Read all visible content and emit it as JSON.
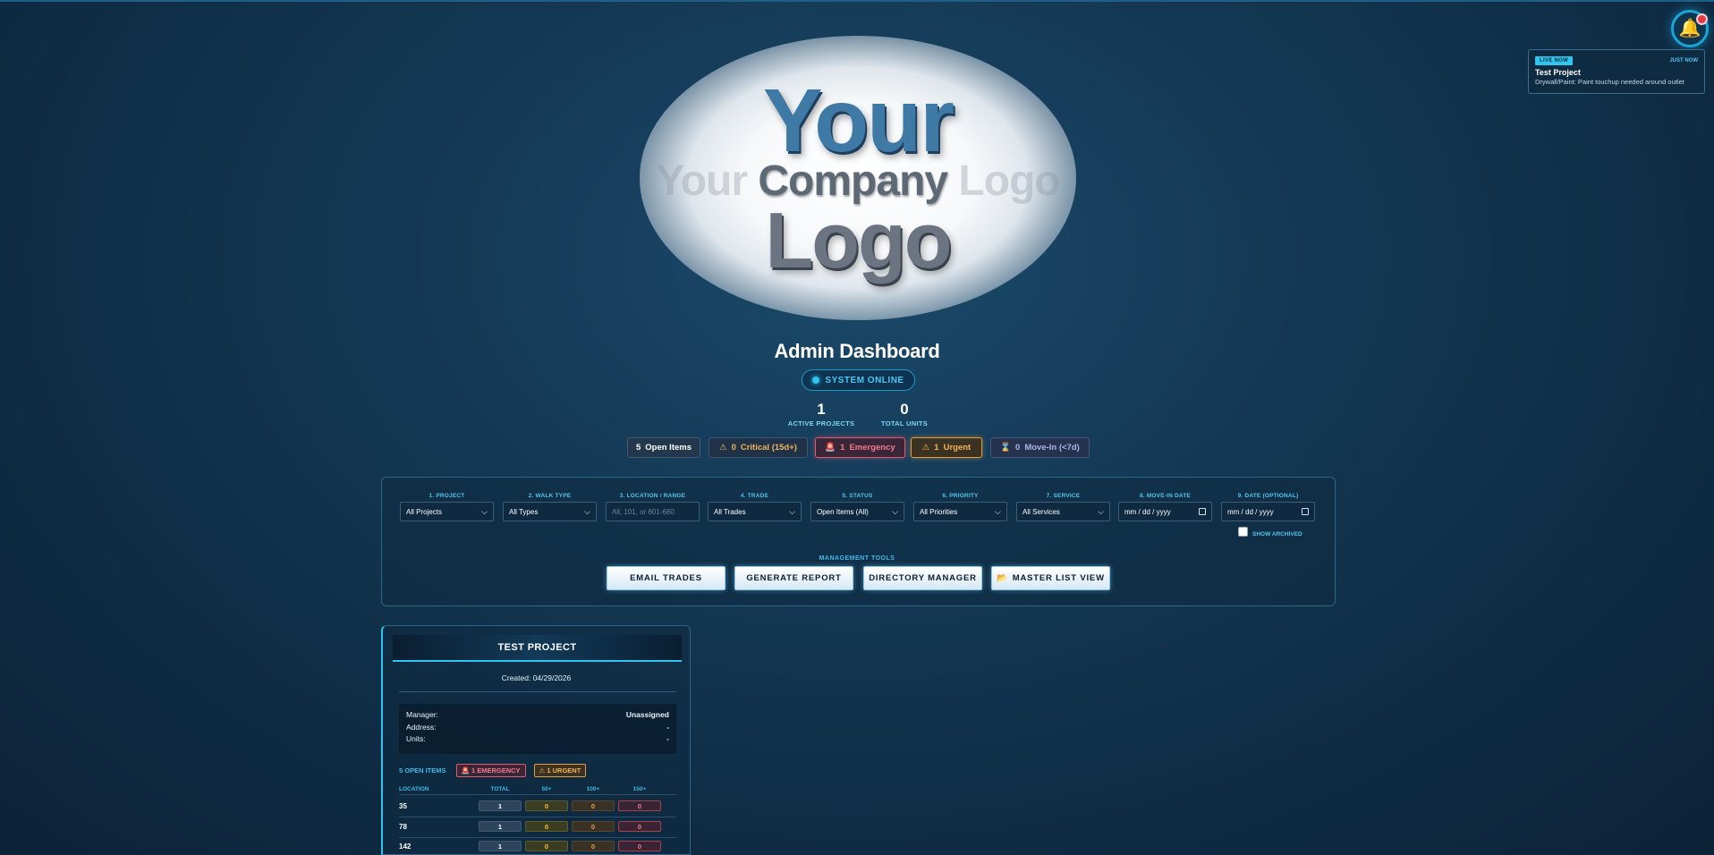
{
  "notification": {
    "badge": "LIVE NOW",
    "time": "JUST NOW",
    "title": "Test Project",
    "message": "Drywall/Paint: Paint touchup needed around outlet"
  },
  "logo": {
    "line1": "Your",
    "line2_faded_left": "Your ",
    "line2_main": "Company",
    "line2_faded_right": " Logo",
    "line3": "Logo"
  },
  "header": {
    "title": "Admin Dashboard",
    "status": "SYSTEM ONLINE"
  },
  "stats": [
    {
      "value": "1",
      "label": "ACTIVE PROJECTS"
    },
    {
      "value": "0",
      "label": "TOTAL UNITS"
    }
  ],
  "chips": {
    "open": {
      "count": "5",
      "label": "Open Items"
    },
    "critical": {
      "icon": "⚠",
      "count": "0",
      "label": "Critical (15d+)"
    },
    "emergency": {
      "icon": "🚨",
      "count": "1",
      "label": "Emergency"
    },
    "urgent": {
      "icon": "⚠",
      "count": "1",
      "label": "Urgent"
    },
    "movein": {
      "icon": "⌛",
      "count": "0",
      "label": "Move-In (<7d)"
    }
  },
  "filters": [
    {
      "label": "1. PROJECT",
      "value": "All Projects",
      "kind": "select"
    },
    {
      "label": "2. WALK TYPE",
      "value": "All Types",
      "kind": "select"
    },
    {
      "label": "3. LOCATION / RANGE",
      "value": "All, 101, or 601-680",
      "kind": "input"
    },
    {
      "label": "4. TRADE",
      "value": "All Trades",
      "kind": "select"
    },
    {
      "label": "5. STATUS",
      "value": "Open Items (All)",
      "kind": "select"
    },
    {
      "label": "6. PRIORITY",
      "value": "All Priorities",
      "kind": "select"
    },
    {
      "label": "7. SERVICE",
      "value": "All Services",
      "kind": "select"
    },
    {
      "label": "8. MOVE-IN DATE",
      "value": "mm / dd / yyyy",
      "kind": "date"
    },
    {
      "label": "9. DATE (OPTIONAL)",
      "value": "mm / dd / yyyy",
      "kind": "date"
    }
  ],
  "show_archived": "SHOW ARCHIVED",
  "management": {
    "label": "MANAGEMENT TOOLS",
    "buttons": [
      "EMAIL TRADES",
      "GENERATE REPORT",
      "DIRECTORY MANAGER",
      "MASTER LIST VIEW"
    ],
    "master_icon": "📂"
  },
  "project": {
    "name": "TEST PROJECT",
    "created": "Created: 04/29/2026",
    "info": [
      {
        "label": "Manager:",
        "value": "Unassigned"
      },
      {
        "label": "Address:",
        "value": "-"
      },
      {
        "label": "Units:",
        "value": "-"
      }
    ],
    "open_items": "5 OPEN ITEMS",
    "emergency_tag": "🚨 1 EMERGENCY",
    "urgent_tag": "⚠ 1 URGENT",
    "table_headers": [
      "LOCATION",
      "TOTAL",
      "50+",
      "100+",
      "150+"
    ],
    "rows": [
      {
        "location": "35",
        "total": "1",
        "d50": "0",
        "d100": "0",
        "d150": "0"
      },
      {
        "location": "78",
        "total": "1",
        "d50": "0",
        "d100": "0",
        "d150": "0"
      },
      {
        "location": "142",
        "total": "1",
        "d50": "0",
        "d100": "0",
        "d150": "0"
      }
    ]
  }
}
